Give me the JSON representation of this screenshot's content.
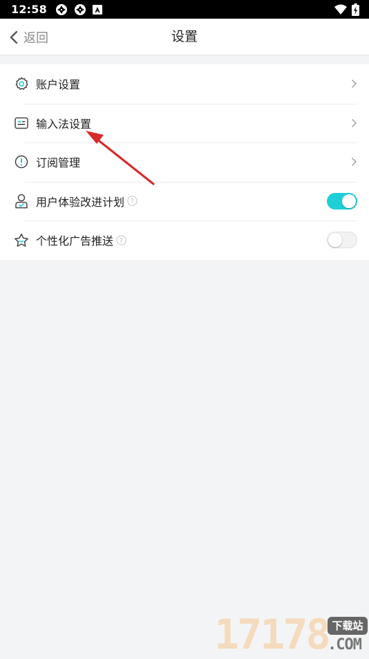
{
  "status_bar": {
    "time": "12:58",
    "left_icons": [
      "sync-icon",
      "sync-icon",
      "app-notification-icon"
    ],
    "right_icons": [
      "wifi-icon",
      "battery-charging-icon"
    ]
  },
  "header": {
    "back_label": "返回",
    "title": "设置"
  },
  "settings": {
    "items": [
      {
        "label": "账户设置",
        "icon": "gear-icon",
        "control": "chevron"
      },
      {
        "label": "输入法设置",
        "icon": "keyboard-icon",
        "control": "chevron"
      },
      {
        "label": "订阅管理",
        "icon": "exclamation-icon",
        "control": "chevron"
      },
      {
        "label": "用户体验改进计划",
        "icon": "user-icon",
        "control": "toggle",
        "checked": true,
        "has_help": true
      },
      {
        "label": "个性化广告推送",
        "icon": "star-icon",
        "control": "toggle",
        "checked": false,
        "has_help": true
      }
    ]
  },
  "help_glyph": "?",
  "watermark": {
    "digits": "17178",
    "badge": "下载站",
    "suffix": ".COM"
  },
  "colors": {
    "accent": "#1ecfd8",
    "background": "#f3f4f6",
    "annotation": "#d62b2b"
  }
}
